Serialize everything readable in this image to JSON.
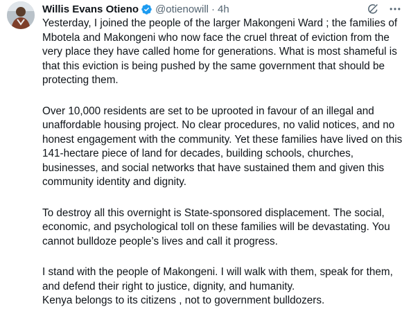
{
  "author": {
    "name": "Willis Evans Otieno",
    "handle": "@otienowill",
    "separator": "·",
    "time": "4h"
  },
  "colors": {
    "text": "#0f1419",
    "secondary": "#536471",
    "verified": "#1d9bf0"
  },
  "icons": {
    "verified": "verified-badge-icon",
    "grok": "grok-icon",
    "more": "more-options-icon"
  },
  "tweet": {
    "paragraphs": [
      "Yesterday, I joined the people of the larger Makongeni Ward ;  the families of Mbotela and Makongeni who now face the cruel threat of eviction from the very place they have called home for generations. What is most shameful is that this eviction is being pushed by the same government that should be protecting them.",
      "Over 10,000 residents are set to be uprooted in favour of an illegal and unaffordable housing project. No clear procedures, no valid notices, and no honest engagement with the community. Yet these families have lived on this 141-hectare piece of land for decades, building schools, churches, businesses, and social networks that have sustained them and given this community identity and dignity.",
      "To destroy all this overnight is State-sponsored displacement. The social, economic, and psychological toll on these families will be devastating. You cannot bulldoze people’s lives and call it progress.",
      "I stand with the people of Makongeni. I will walk with them, speak for them, and defend their right to justice, dignity, and humanity.\nKenya belongs to its citizens , not to government bulldozers."
    ]
  }
}
